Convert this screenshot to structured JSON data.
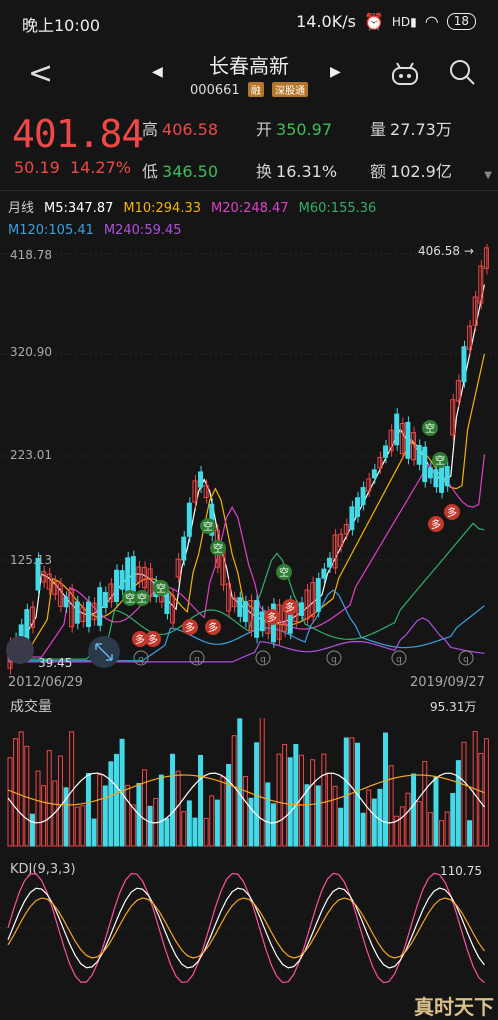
{
  "status": {
    "time": "晚上10:00",
    "net": "14.0K/s",
    "battery": "18"
  },
  "header": {
    "name": "长春高新",
    "code": "000661",
    "tag1": "融",
    "tag2": "深股通"
  },
  "quote": {
    "price": "401.84",
    "change": "50.19",
    "change_pct": "14.27%",
    "high_label": "高",
    "high": "406.58",
    "low_label": "低",
    "low": "346.50",
    "open_label": "开",
    "open": "350.97",
    "turn_label": "换",
    "turn": "16.31%",
    "vol_label": "量",
    "vol": "27.73万",
    "amt_label": "额",
    "amt": "102.9亿"
  },
  "ma": {
    "period": "月线",
    "m5": "M5:347.87",
    "m10": "M10:294.33",
    "m20": "M20:248.47",
    "m60": "M60:155.36",
    "m120": "M120:105.41",
    "m240": "M240:59.45"
  },
  "colors": {
    "up": "#f04848",
    "down": "#44d9e6",
    "m5": "#ffffff",
    "m10": "#f5b400",
    "m20": "#e040c8",
    "m60": "#2fb06b",
    "m120": "#3aa0e0",
    "m240": "#b050e0"
  },
  "chart": {
    "y_ticks": [
      "418.78",
      "320.90",
      "223.01",
      "125.13"
    ],
    "max_label": "406.58",
    "min_label": "39.45",
    "date_start": "2012/06/29",
    "date_end": "2019/09/27",
    "signal_buy": "多",
    "signal_sell": "空",
    "q_mark": "q"
  },
  "volume": {
    "title": "成交量",
    "max": "95.31万"
  },
  "kdj": {
    "title": "KDJ(9,3,3)",
    "max": "110.75"
  },
  "watermark": "真时天下"
}
